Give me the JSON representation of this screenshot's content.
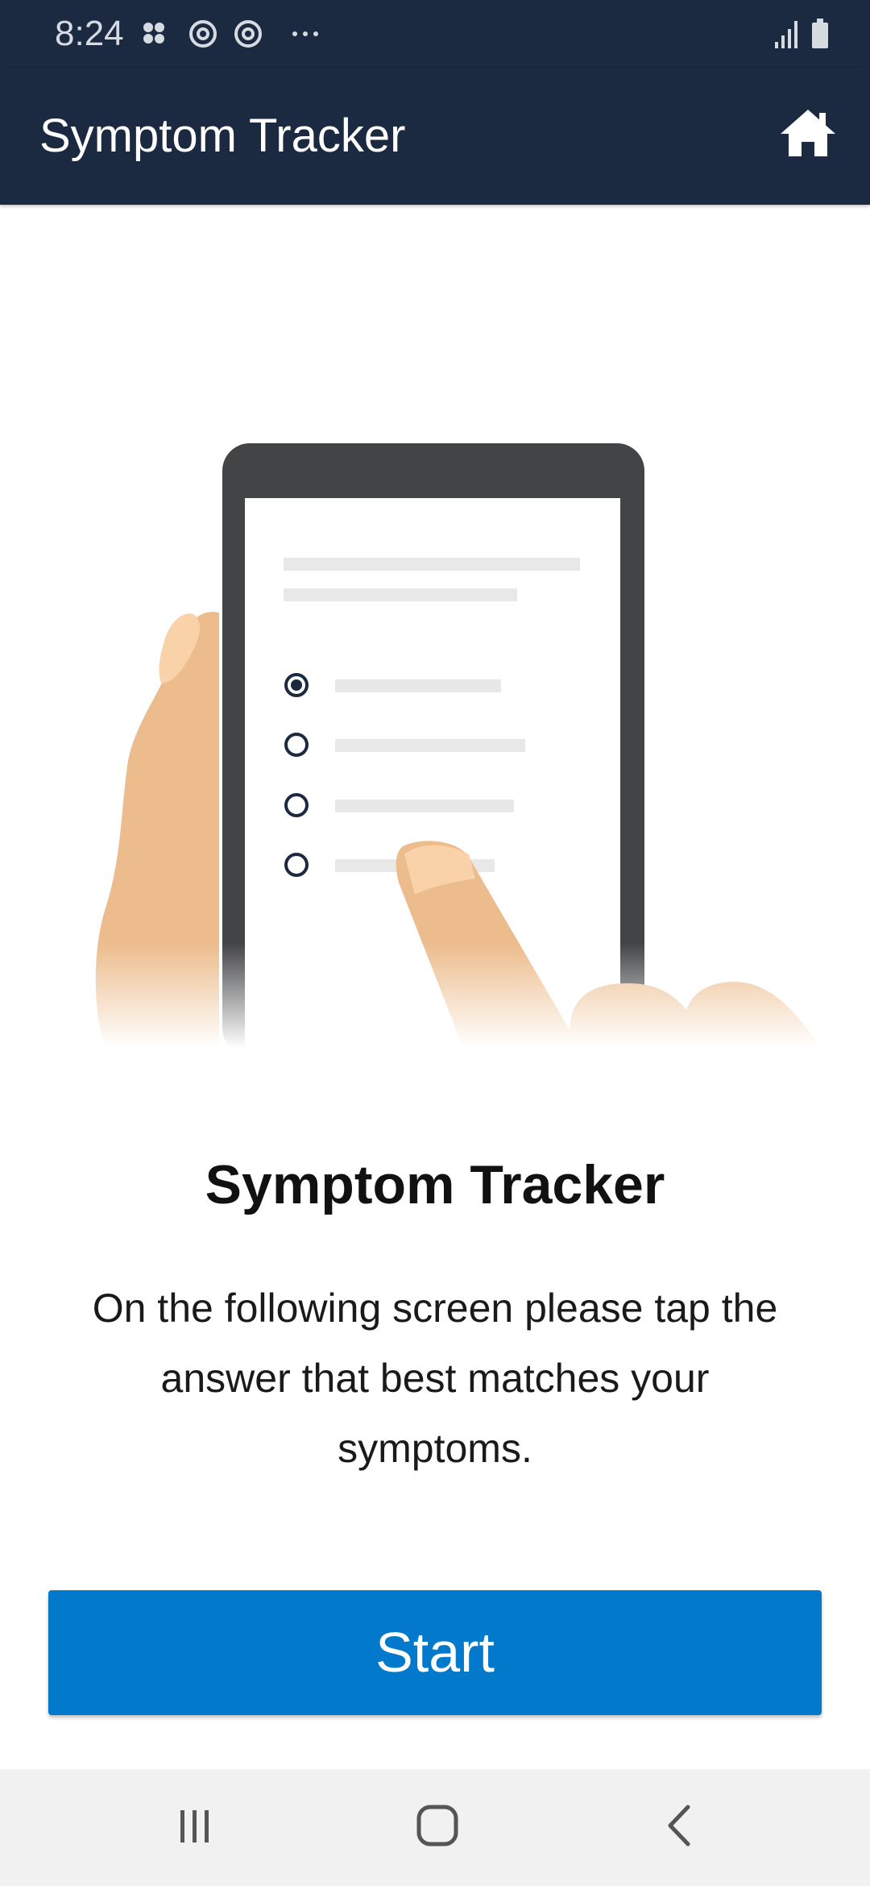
{
  "status_bar": {
    "time": "8:24",
    "icons_left": [
      "app-grid-icon",
      "sync-icon",
      "sync-icon",
      "more-dots-icon"
    ],
    "icons_right": [
      "signal-icon",
      "battery-icon"
    ]
  },
  "app_bar": {
    "title": "Symptom Tracker",
    "home_icon": "home-icon"
  },
  "illustration": {
    "description_icon": "hand-holding-phone-survey-illustration",
    "options_count": 4,
    "selected_option": 1
  },
  "content": {
    "heading": "Symptom Tracker",
    "body": "On the following screen please tap the answer that best matches your symptoms."
  },
  "actions": {
    "start_label": "Start"
  },
  "nav_bar": {
    "icons": [
      "recent-apps-icon",
      "home-circle-icon",
      "back-icon"
    ]
  },
  "colors": {
    "app_bar": "#1b2a40",
    "primary_button": "#0279ca",
    "nav_bar": "#f1f1f1"
  }
}
